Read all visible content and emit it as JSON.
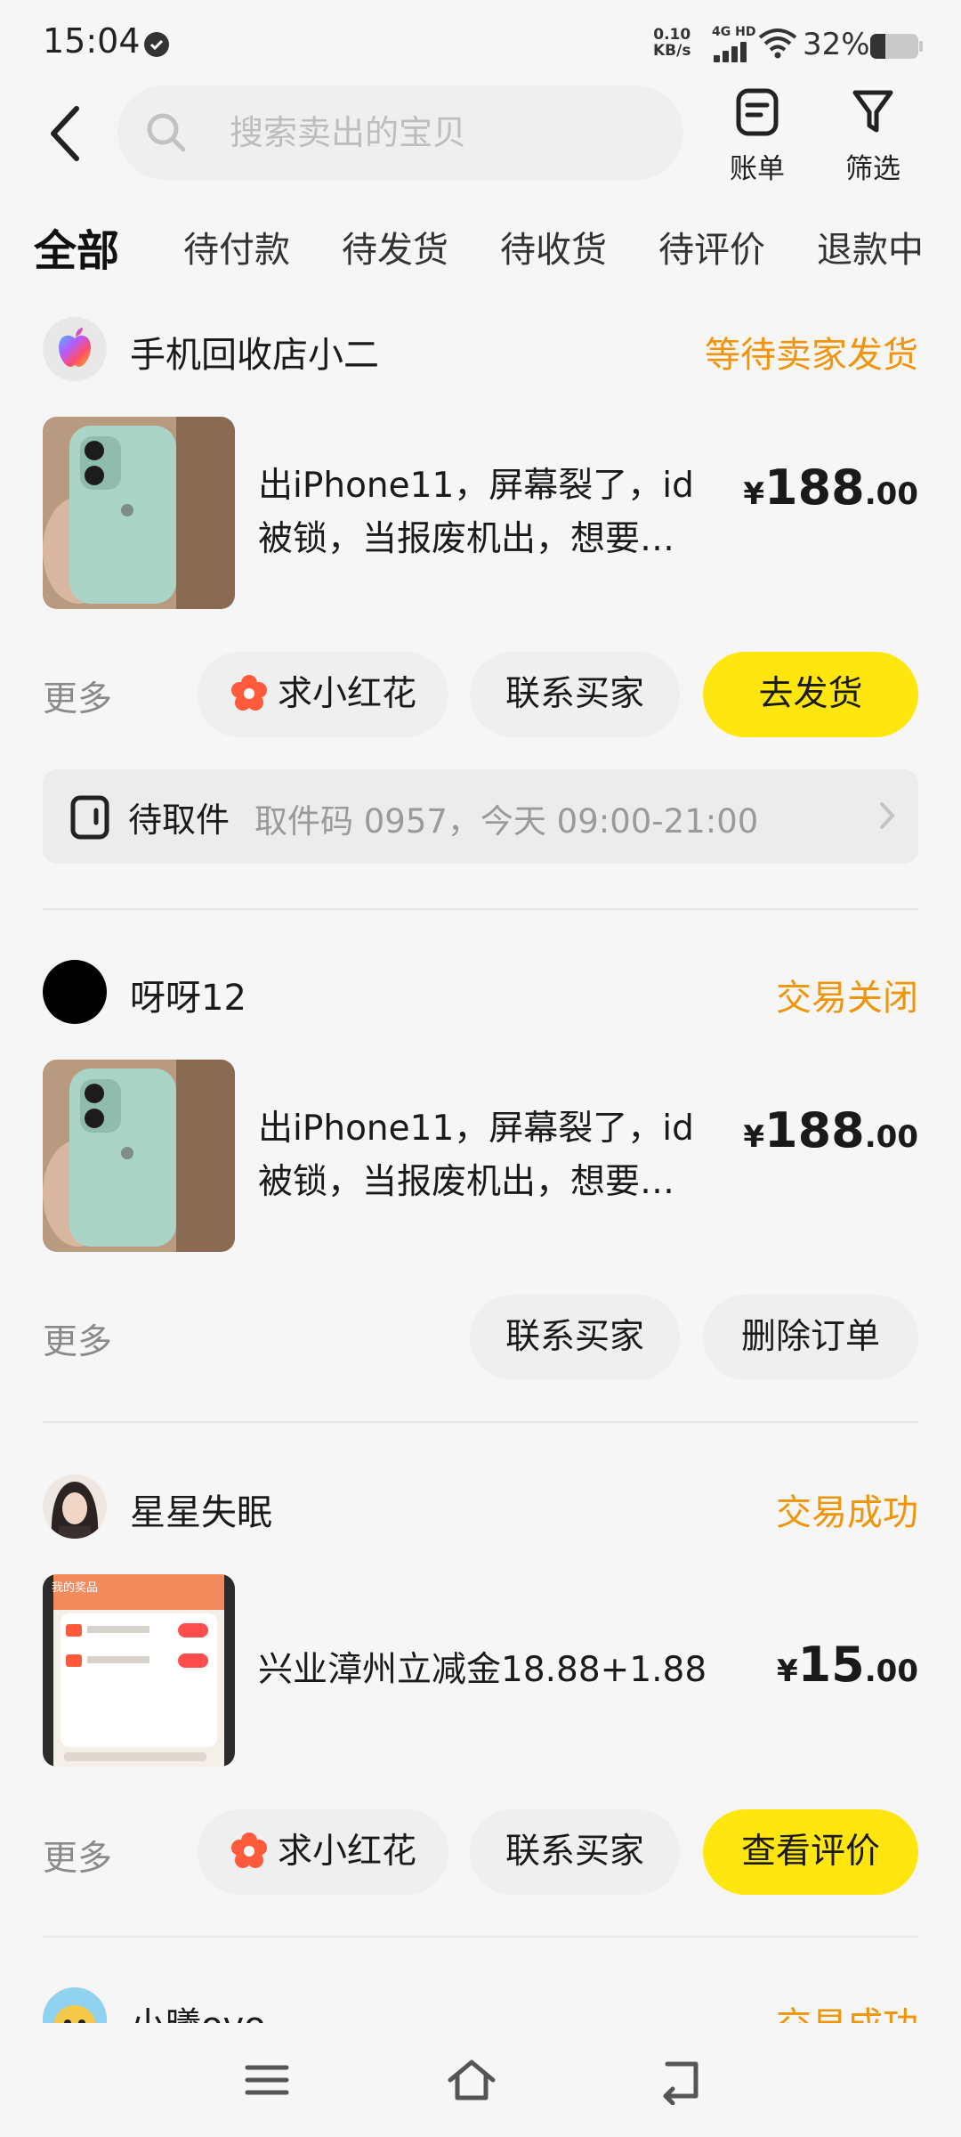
{
  "status_bar": {
    "time": "15:04",
    "net_speed_value": "0.10",
    "net_speed_unit": "KB/s",
    "signal_label": "4G HD",
    "battery_text": "32%",
    "battery_level": 0.32
  },
  "header": {
    "search_placeholder": "搜索卖出的宝贝",
    "bill_label": "账单",
    "filter_label": "筛选"
  },
  "tabs": [
    "全部",
    "待付款",
    "待发货",
    "待收货",
    "待评价",
    "退款中"
  ],
  "active_tab_index": 0,
  "orders": [
    {
      "shop_name": "手机回收店小二",
      "status": "等待卖家发货",
      "title_line1": "出iPhone11，屏幕裂了，id",
      "title_line2": "被锁，当报废机出，想要…",
      "price_currency": "¥",
      "price_int": "188",
      "price_dec": ".00",
      "more_label": "更多",
      "buttons": [
        "求小红花",
        "联系买家",
        "去发货"
      ],
      "pickup": {
        "title": "待取件",
        "info": "取件码 0957，今天 09:00-21:00"
      }
    },
    {
      "shop_name": "呀呀12",
      "status": "交易关闭",
      "title_line1": "出iPhone11，屏幕裂了，id",
      "title_line2": "被锁，当报废机出，想要…",
      "price_currency": "¥",
      "price_int": "188",
      "price_dec": ".00",
      "more_label": "更多",
      "buttons": [
        "联系买家",
        "删除订单"
      ]
    },
    {
      "shop_name": "星星失眠",
      "status": "交易成功",
      "title_line1": "兴业漳州立减金18.88+1.88",
      "thumb_caption": "我的奖品",
      "price_currency": "¥",
      "price_int": "15",
      "price_dec": ".00",
      "more_label": "更多",
      "buttons": [
        "求小红花",
        "联系买家",
        "查看评价"
      ]
    },
    {
      "shop_name": "小曦ovo",
      "status": "交易成功"
    }
  ],
  "colors": {
    "accent_yellow": "#ffe60f",
    "status_orange": "#f0940a",
    "background": "#f6f6f6"
  },
  "icons": [
    "check-badge-icon",
    "wifi-icon",
    "back-arrow-icon",
    "search-icon",
    "bill-icon",
    "filter-icon",
    "flower-icon",
    "pickup-box-icon",
    "chevron-right-icon",
    "menu-icon",
    "home-icon",
    "back-nav-icon"
  ]
}
